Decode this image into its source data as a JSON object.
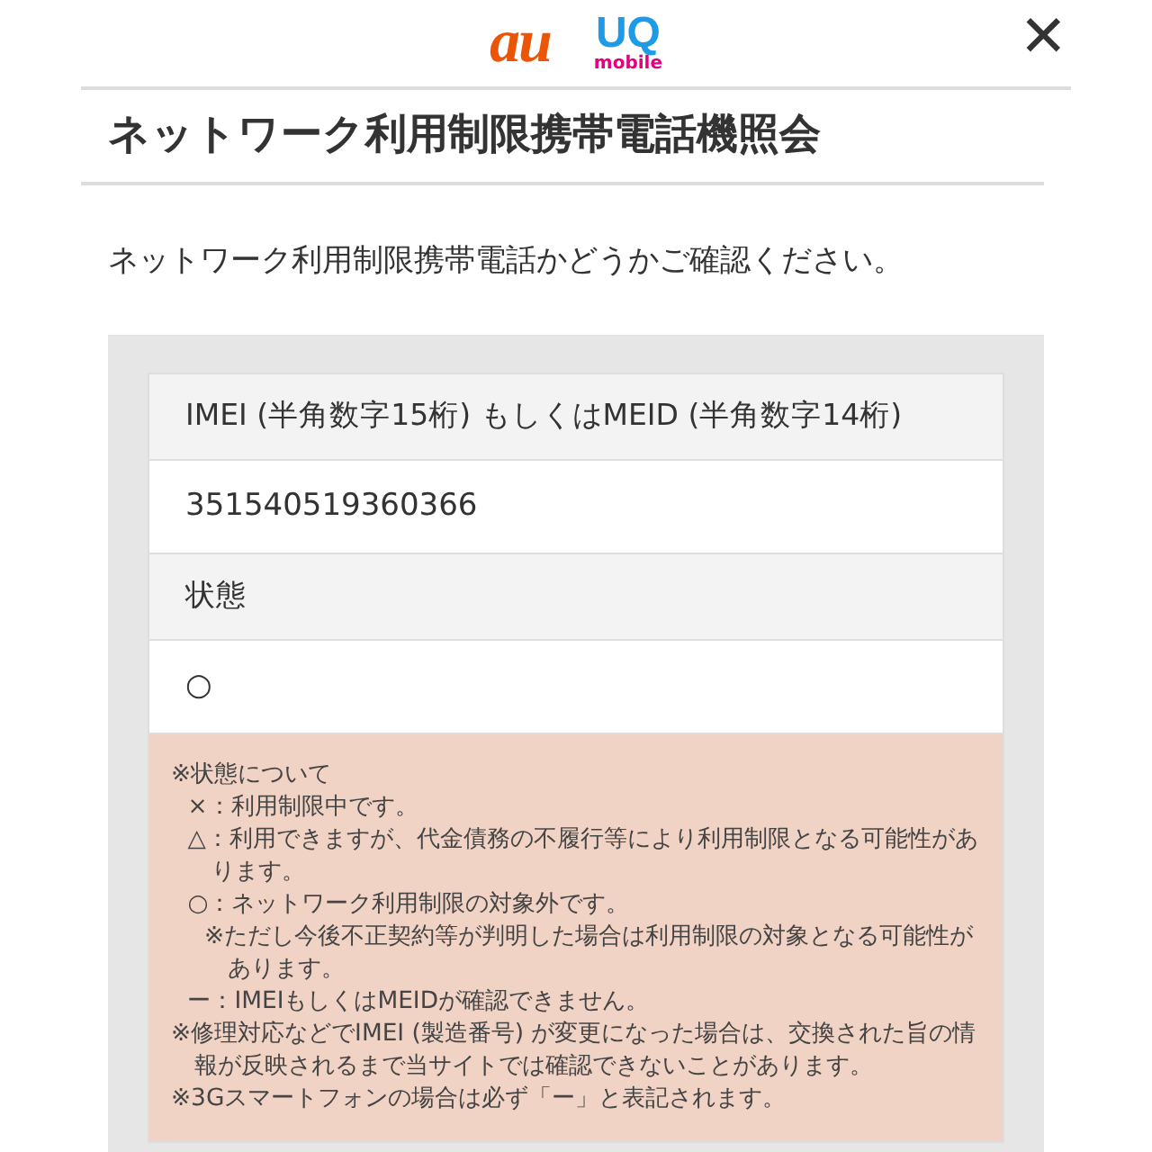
{
  "header": {
    "logo_au": "au",
    "logo_uq": "UQ",
    "logo_uq_sub": "mobile",
    "close": "✕"
  },
  "title": "ネットワーク利用制限携帯電話機照会",
  "intro": "ネットワーク利用制限携帯電話かどうかご確認ください。",
  "fields": [
    {
      "label": "IMEI (半角数字15桁) もしくはMEID (半角数字14桁)",
      "value": "351540519360366"
    },
    {
      "label": "状態",
      "value": "○"
    }
  ],
  "notes": [
    {
      "text": "※状態について",
      "children": [
        {
          "text": "×：利用制限中です。"
        },
        {
          "text": "△：利用できますが、代金債務の不履行等により利用制限となる可能性があります。"
        },
        {
          "text": "○：ネットワーク利用制限の対象外です。",
          "children": [
            {
              "text": "※ただし今後不正契約等が判明した場合は利用制限の対象となる可能性があります。"
            }
          ]
        },
        {
          "text": "ー：IMEIもしくはMEIDが確認できません。"
        }
      ]
    },
    {
      "text": "※修理対応などでIMEI (製造番号) が変更になった場合は、交換された旨の情報が反映されるまで当サイトでは確認できないことがあります。"
    },
    {
      "text": "※3Gスマートフォンの場合は必ず「ー」と表記されます。"
    }
  ]
}
